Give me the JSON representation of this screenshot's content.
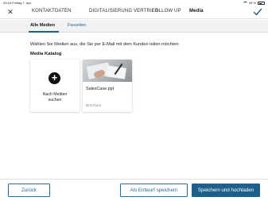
{
  "status_bar": {
    "time": "09:16",
    "date": "Freitag 7. Apr.",
    "battery": "49 %"
  },
  "header": {
    "tabs": [
      {
        "label": "KONTAKTDATEN",
        "active": false
      },
      {
        "label": "DIGITALISIERUNG VERTRIEB",
        "active": false
      },
      {
        "label": "FOLLOW UP",
        "active": false
      },
      {
        "label": "Media",
        "active": true
      }
    ],
    "close_icon": "close-icon",
    "confirm_icon": "checkmark-icon"
  },
  "subtabs": [
    {
      "label": "Alle Medien",
      "active": true
    },
    {
      "label": "Favoriten",
      "active": false
    }
  ],
  "main": {
    "hint": "Wählen Sie Medien aus, die Sie per E-Mail mit dem Kunden teilen möchten",
    "section_title": "Media Katalog",
    "add_card": {
      "icon": "plus-icon",
      "label_line1": "Nach Medien",
      "label_line2": "suchen"
    },
    "items": [
      {
        "name": "SalesCase.ppt",
        "type": "Brochure"
      }
    ]
  },
  "footer": {
    "back_label": "Zurück",
    "draft_label": "Als Entwurf speichern",
    "save_label": "Speichern und hochladen"
  },
  "colors": {
    "accent": "#1f5f8b",
    "subtab_bg": "#f1f2f3"
  }
}
